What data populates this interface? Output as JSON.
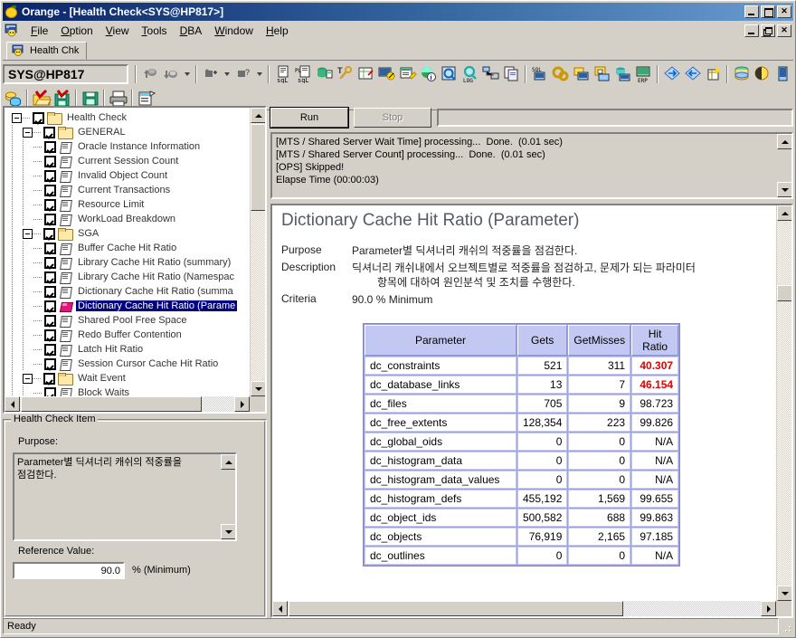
{
  "window": {
    "title": "Orange - [Health Check<SYS@HP817>]",
    "app_icon": "orange-fruit-icon",
    "controls": {
      "minimize": "_",
      "maximize": "□",
      "restore": "❐",
      "close": "✕"
    }
  },
  "menubar": {
    "doc_icon": "mdi-document-icon",
    "items": [
      {
        "label": "File",
        "accel": "F"
      },
      {
        "label": "Option",
        "accel": "O"
      },
      {
        "label": "View",
        "accel": "V"
      },
      {
        "label": "Tools",
        "accel": "T"
      },
      {
        "label": "DBA",
        "accel": "D"
      },
      {
        "label": "Window",
        "accel": "W"
      },
      {
        "label": "Help",
        "accel": "H"
      }
    ]
  },
  "tabs": [
    {
      "label": "Health Chk",
      "icon": "health-check-icon",
      "active": true
    }
  ],
  "connection": {
    "value": "SYS@HP817",
    "toolbar_icons": [
      "commit-icon",
      "rollback-icon",
      "rollback-dropdown",
      "execute-icon",
      "execute-dropdown",
      "execute-explain-icon",
      "explain-dropdown",
      "sql-editor-icon",
      "pl-sql-editor-icon",
      "object-browser-icon",
      "sql-tuning-icon",
      "plan-table-icon",
      "session-monitor-icon",
      "report-editor-icon",
      "db-info-icon",
      "search-object-icon",
      "log-miner-icon",
      "network-icon",
      "copy-object-icon",
      "sql-monitor-icon",
      "instance-manager-icon",
      "storage-manager-icon",
      "security-manager-icon",
      "user-manager-icon",
      "erp-icon",
      "data-export-icon",
      "data-import-icon",
      "data-builder-icon",
      "tablespace-icon",
      "dba-studio-icon",
      "space-analyzer-icon"
    ]
  },
  "toolbar2": {
    "icons": [
      "new-session-icon",
      "open-file-icon",
      "save-file-icon",
      "save-as-icon",
      "print-icon",
      "properties-icon"
    ]
  },
  "tree": {
    "nodes": [
      {
        "label": "Health Check",
        "level": 0,
        "type": "folder",
        "expander": "minus",
        "checked": true,
        "selected": false
      },
      {
        "label": "GENERAL",
        "level": 1,
        "type": "folder",
        "expander": "minus",
        "checked": true,
        "selected": false
      },
      {
        "label": "Oracle Instance Information",
        "level": 2,
        "type": "doc",
        "expander": "",
        "checked": true,
        "selected": false
      },
      {
        "label": "Current Session Count",
        "level": 2,
        "type": "doc",
        "expander": "",
        "checked": true,
        "selected": false
      },
      {
        "label": "Invalid Object Count",
        "level": 2,
        "type": "doc",
        "expander": "",
        "checked": true,
        "selected": false
      },
      {
        "label": "Current Transactions",
        "level": 2,
        "type": "doc",
        "expander": "",
        "checked": true,
        "selected": false
      },
      {
        "label": "Resource Limit",
        "level": 2,
        "type": "doc",
        "expander": "",
        "checked": true,
        "selected": false
      },
      {
        "label": "WorkLoad Breakdown",
        "level": 2,
        "type": "doc",
        "expander": "",
        "checked": true,
        "selected": false
      },
      {
        "label": "SGA",
        "level": 1,
        "type": "folder",
        "expander": "minus",
        "checked": true,
        "selected": false
      },
      {
        "label": "Buffer Cache Hit Ratio",
        "level": 2,
        "type": "doc",
        "expander": "",
        "checked": true,
        "selected": false
      },
      {
        "label": "Library Cache Hit Ratio (summary)",
        "level": 2,
        "type": "doc",
        "expander": "",
        "checked": true,
        "selected": false
      },
      {
        "label": "Library Cache Hit Ratio (Namespac",
        "level": 2,
        "type": "doc",
        "expander": "",
        "checked": true,
        "selected": false
      },
      {
        "label": "Dictionary Cache Hit Ratio (summa",
        "level": 2,
        "type": "doc",
        "expander": "",
        "checked": true,
        "selected": false
      },
      {
        "label": "Dictionary Cache Hit Ratio (Parame",
        "level": 2,
        "type": "gem",
        "expander": "",
        "checked": true,
        "selected": true
      },
      {
        "label": "Shared Pool Free Space",
        "level": 2,
        "type": "doc",
        "expander": "",
        "checked": true,
        "selected": false
      },
      {
        "label": "Redo Buffer Contention",
        "level": 2,
        "type": "doc",
        "expander": "",
        "checked": true,
        "selected": false
      },
      {
        "label": "Latch Hit Ratio",
        "level": 2,
        "type": "doc",
        "expander": "",
        "checked": true,
        "selected": false
      },
      {
        "label": "Session Cursor Cache Hit Ratio",
        "level": 2,
        "type": "doc",
        "expander": "",
        "checked": true,
        "selected": false
      },
      {
        "label": "Wait Event",
        "level": 1,
        "type": "folder",
        "expander": "minus",
        "checked": true,
        "selected": false
      },
      {
        "label": "Block Waits",
        "level": 2,
        "type": "doc",
        "expander": "",
        "checked": true,
        "selected": false
      }
    ]
  },
  "item_panel": {
    "group_title": "Health Check Item",
    "purpose_label": "Purpose:",
    "purpose_text": "Parameter별 딕셔너리 캐쉬의 적중률을\n점검한다.",
    "reference_label": "Reference Value:",
    "reference_value": "90.0",
    "reference_unit": "% (Minimum)"
  },
  "actions": {
    "run_label": "Run",
    "stop_label": "Stop",
    "progress_value": ""
  },
  "log": {
    "lines": [
      "[MTS / Shared Server Wait Time] processing...  Done.  (0.01 sec)",
      "[MTS / Shared Server Count] processing...  Done.  (0.01 sec)",
      "[OPS] Skipped!",
      "Elapse Time (00:00:03)"
    ]
  },
  "report": {
    "title": "Dictionary Cache Hit Ratio (Parameter)",
    "purpose_key": "Purpose",
    "purpose_value": "Parameter별 딕셔너리 캐쉬의 적중률을 점검한다.",
    "description_key": "Description",
    "description_value": "딕셔너리 캐쉬내에서 오브젝트별로 적중률을 점검하고, 문제가 되는 파라미터",
    "description_value2": "항목에 대하여 원인분석 및 조치를 수행한다.",
    "criteria_key": "Criteria",
    "criteria_value": "90.0 % Minimum"
  },
  "table": {
    "columns": [
      "Parameter",
      "Gets",
      "GetMisses",
      "Hit Ratio"
    ],
    "rows": [
      {
        "parameter": "dc_constraints",
        "gets": "521",
        "getmisses": "311",
        "hit_ratio": "40.307",
        "bad": true
      },
      {
        "parameter": "dc_database_links",
        "gets": "13",
        "getmisses": "7",
        "hit_ratio": "46.154",
        "bad": true
      },
      {
        "parameter": "dc_files",
        "gets": "705",
        "getmisses": "9",
        "hit_ratio": "98.723",
        "bad": false
      },
      {
        "parameter": "dc_free_extents",
        "gets": "128,354",
        "getmisses": "223",
        "hit_ratio": "99.826",
        "bad": false
      },
      {
        "parameter": "dc_global_oids",
        "gets": "0",
        "getmisses": "0",
        "hit_ratio": "N/A",
        "bad": false
      },
      {
        "parameter": "dc_histogram_data",
        "gets": "0",
        "getmisses": "0",
        "hit_ratio": "N/A",
        "bad": false
      },
      {
        "parameter": "dc_histogram_data_values",
        "gets": "0",
        "getmisses": "0",
        "hit_ratio": "N/A",
        "bad": false
      },
      {
        "parameter": "dc_histogram_defs",
        "gets": "455,192",
        "getmisses": "1,569",
        "hit_ratio": "99.655",
        "bad": false
      },
      {
        "parameter": "dc_object_ids",
        "gets": "500,582",
        "getmisses": "688",
        "hit_ratio": "99.863",
        "bad": false
      },
      {
        "parameter": "dc_objects",
        "gets": "76,919",
        "getmisses": "2,165",
        "hit_ratio": "97.185",
        "bad": false
      },
      {
        "parameter": "dc_outlines",
        "gets": "0",
        "getmisses": "0",
        "hit_ratio": "N/A",
        "bad": false
      }
    ]
  },
  "statusbar": {
    "text": "Ready"
  },
  "colors": {
    "titlebar_start": "#0a246a",
    "titlebar_end": "#6a9bd0",
    "face": "#d4d0c8",
    "table_header": "#c3c8f2",
    "table_border": "#9aa0dd",
    "bad_value": "#e00000",
    "selection": "#000080",
    "report_title": "#555a66"
  }
}
